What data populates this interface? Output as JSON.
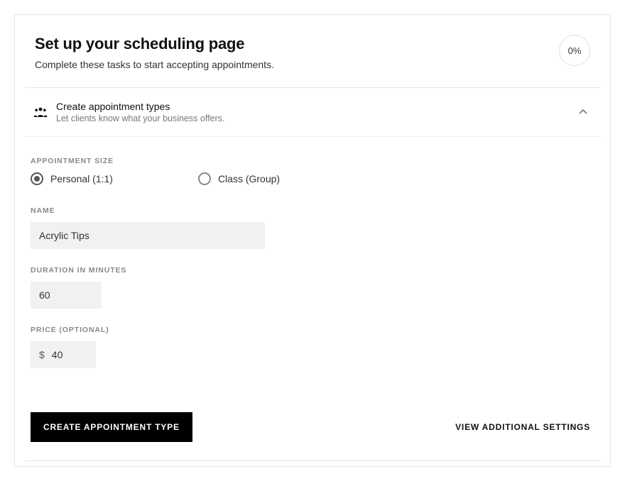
{
  "header": {
    "title": "Set up your scheduling page",
    "subtitle": "Complete these tasks to start accepting appointments.",
    "progress_label": "0%"
  },
  "section": {
    "title": "Create appointment types",
    "description": "Let clients know what your business offers."
  },
  "form": {
    "size_label": "APPOINTMENT SIZE",
    "size_options": {
      "personal": "Personal (1:1)",
      "class": "Class (Group)"
    },
    "name_label": "NAME",
    "name_value": "Acrylic Tips",
    "duration_label": "DURATION IN MINUTES",
    "duration_value": "60",
    "price_label": "PRICE (OPTIONAL)",
    "price_currency": "$",
    "price_value": "40"
  },
  "actions": {
    "create_label": "CREATE APPOINTMENT TYPE",
    "additional_label": "VIEW ADDITIONAL SETTINGS"
  }
}
